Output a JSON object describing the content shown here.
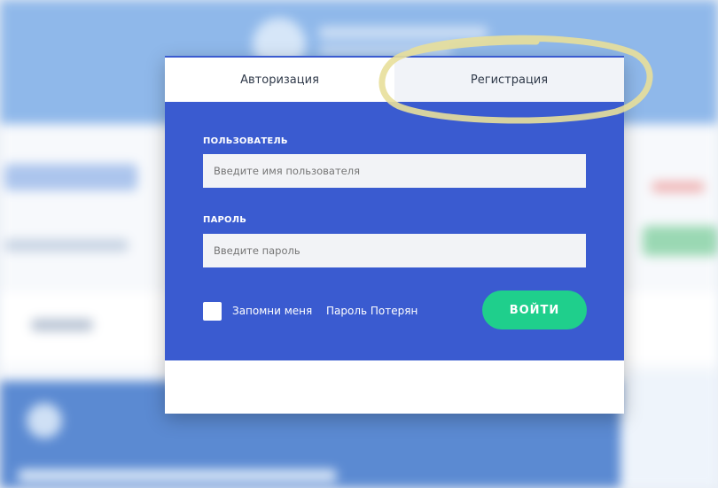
{
  "tabs": {
    "login": "Авторизация",
    "register": "Регистрация"
  },
  "form": {
    "user_label": "ПОЛЬЗОВАТЕЛЬ",
    "user_placeholder": "Введите имя пользователя",
    "pass_label": "ПАРОЛЬ",
    "pass_placeholder": "Введите пароль",
    "remember_label": "Запомни меня",
    "lost_password_label": "Пароль Потерян",
    "login_button": "ВОЙТИ"
  },
  "colors": {
    "form_bg": "#3a5bd0",
    "button": "#1fcf8c",
    "highlight": "#e8df9a"
  },
  "annotation": {
    "shape": "ellipse",
    "target": "tab-register"
  }
}
